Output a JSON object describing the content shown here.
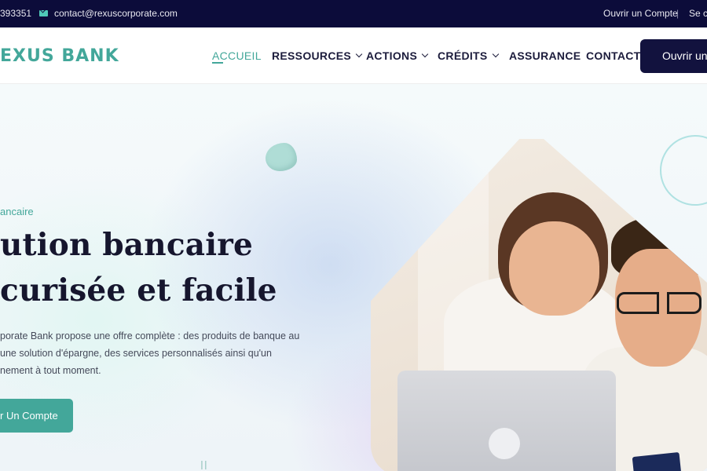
{
  "topbar": {
    "phone": "393351",
    "email": "contact@rexuscorporate.com",
    "open_account": "Ouvrir un Compte",
    "separator": "|",
    "login": "Se co"
  },
  "header": {
    "logo": "EXUS BANK",
    "nav": [
      {
        "label": "ACCUEIL",
        "active": true,
        "dropdown": false
      },
      {
        "label": "RESSOURCES",
        "dropdown": true
      },
      {
        "label": "ACTIONS",
        "dropdown": true
      },
      {
        "label": "CRÉDITS",
        "dropdown": true
      },
      {
        "label": "ASSURANCE",
        "dropdown": false
      },
      {
        "label": "CONTACT",
        "dropdown": false
      }
    ],
    "cta": "Ouvrir un C"
  },
  "hero": {
    "eyebrow": "ancaire",
    "title_line1": "ution bancaire",
    "title_line2": "curisée et facile",
    "description": [
      "porate Bank propose une offre complète : des produits de banque au",
      "une solution d'épargne, des services personnalisés ainsi qu'un",
      "nement à tout moment."
    ],
    "cta": "r Un Compte"
  },
  "colors": {
    "topbar_bg": "#0c0c3a",
    "accent": "#43a79a",
    "cta_dark": "#12123e",
    "heading": "#16162e"
  }
}
